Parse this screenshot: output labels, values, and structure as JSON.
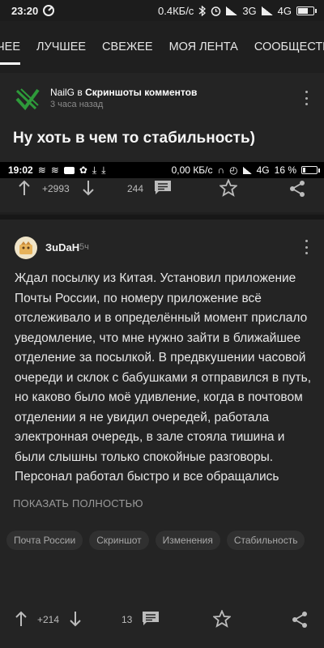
{
  "status_bar": {
    "time": "23:20",
    "speed": "0.4КБ/с",
    "network": "3G",
    "network2": "4G"
  },
  "tabs": [
    {
      "label": "ЧЕЕ"
    },
    {
      "label": "ЛУЧШЕЕ"
    },
    {
      "label": "СВЕЖЕЕ"
    },
    {
      "label": "МОЯ ЛЕНТА"
    },
    {
      "label": "СООБЩЕСТВА"
    }
  ],
  "post": {
    "author": "NailG",
    "in_word": "в",
    "community": "Скриншоты комментов",
    "time": "3 часа назад",
    "title": "Ну хоть в чем то стабильность)",
    "rating": "+2993",
    "comments": "244"
  },
  "overlay_status": {
    "time": "19:02",
    "speed": "0,00 КБ/с",
    "network": "4G",
    "battery": "16 %"
  },
  "comment": {
    "author": "ЗuDaH",
    "time": "5ч",
    "text": "Ждал посылку из Китая. Установил приложение Почты России, по номеру приложение всё отслеживало и в определённый момент прислало уведомление, что мне нужно зайти в ближайшее отделение за посылкой. В предвкушении часовой очереди и склок с бабушками я отправился в путь, но каково было моё удивление, когда в почтовом отделении я не увидил очередей, работала электронная очередь, в зале стояла тишина и были слышны только спокойные разговоры. Персонал работал быстро и все обращались",
    "show_full": "ПОКАЗАТЬ ПОЛНОСТЬЮ",
    "tags": [
      "Почта России",
      "Скриншот",
      "Изменения",
      "Стабильность"
    ],
    "rating": "+214",
    "comments": "13"
  },
  "icons": [
    "arrow-up-icon",
    "arrow-down-icon",
    "comment-icon",
    "star-icon",
    "share-icon",
    "more-icon"
  ],
  "colors": {
    "background": "#1f1f1f",
    "card": "#242424",
    "logo_green": "#2e9a3a"
  }
}
